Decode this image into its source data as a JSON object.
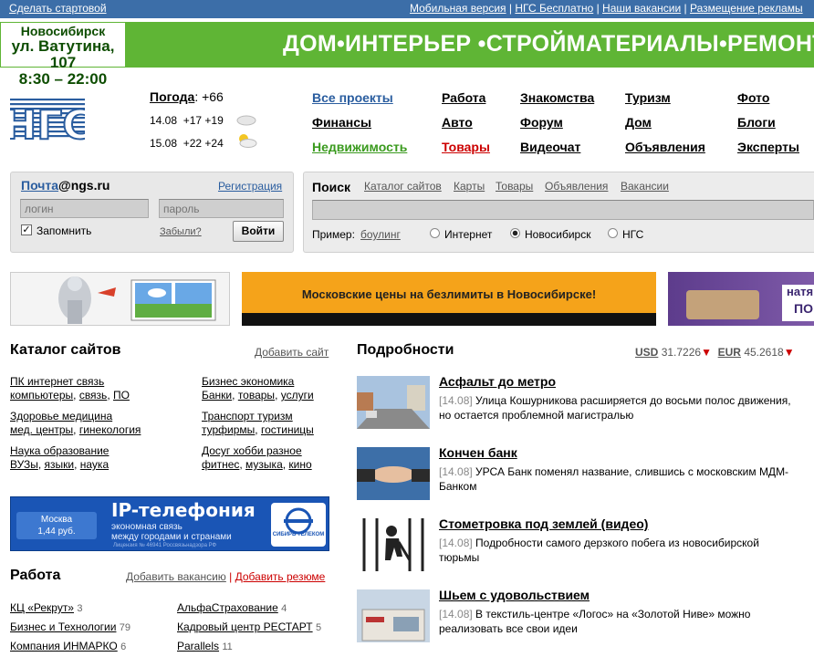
{
  "topbar": {
    "make_home": "Сделать стартовой",
    "links": [
      "Мобильная версия",
      "НГС Бесплатно",
      "Наши вакансии",
      "Размещение рекламы"
    ]
  },
  "banner": {
    "addr_city": "Новосибирск",
    "addr_street": "ул. Ватутина, 107",
    "addr_hours": "8:30 – 22:00",
    "text": "ДОМ•ИНТЕРЬЕР •СТРОЙМАТЕРИАЛЫ•РЕМОНТ •"
  },
  "logo": {
    "text": "НГС"
  },
  "weather": {
    "label": "Погода",
    "current": ": +66",
    "rows": [
      {
        "date": "14.08",
        "temps": "+17 +19"
      },
      {
        "date": "15.08",
        "temps": "+22 +24"
      }
    ]
  },
  "projects": [
    [
      "Все проекты",
      "Работа",
      "Знакомства",
      "Туризм",
      "Фото"
    ],
    [
      "Финансы",
      "Авто",
      "Форум",
      "Дом",
      "Блоги"
    ],
    [
      "Недвижимость",
      "Товары",
      "Видеочат",
      "Объявления",
      "Эксперты"
    ]
  ],
  "mail": {
    "link": "Почта",
    "domain": "@ngs.ru",
    "register": "Регистрация",
    "login_placeholder": "логин",
    "password_placeholder": "пароль",
    "remember": "Запомнить",
    "forgot": "Забыли?",
    "submit": "Войти"
  },
  "search": {
    "label": "Поиск",
    "tabs": [
      "Каталог сайтов",
      "Карты",
      "Товары",
      "Объявления",
      "Вакансии"
    ],
    "example_label": "Пример:",
    "example_link": "боулинг",
    "scopes": [
      "Интернет",
      "Новосибирск",
      "НГС"
    ],
    "selected_scope": "Новосибирск"
  },
  "ads": {
    "middle_text": "Московские цены на безлимиты в Новосибирске!",
    "right_text_1": "натя",
    "right_text_2": "ПО"
  },
  "catalog": {
    "title": "Каталог сайтов",
    "add": "Добавить сайт",
    "groups": [
      {
        "head": "ПК интернет связь",
        "items": [
          "компьютеры",
          "связь",
          "ПО"
        ]
      },
      {
        "head": "Бизнес экономика",
        "items": [
          "Банки",
          "товары",
          "услуги"
        ]
      },
      {
        "head": "Здоровье медицина",
        "items": [
          "мед. центры",
          "гинекология"
        ]
      },
      {
        "head": "Транспорт туризм",
        "items": [
          "турфирмы",
          "гостиницы"
        ]
      },
      {
        "head": "Наука образование",
        "items": [
          "ВУЗы",
          "языки",
          "наука"
        ]
      },
      {
        "head": "Досуг хобби разное",
        "items": [
          "фитнес",
          "музыка",
          "кино"
        ]
      }
    ]
  },
  "ip_ad": {
    "title": "IP-телефония",
    "city": "Москва",
    "price": "1,44 руб.",
    "line1": "экономная связь",
    "line2": "между городами и странами",
    "license": "Лицензия № 46941 Россвязьнадзора РФ",
    "brand": "СИБИРЬ ТЕЛЕКОМ"
  },
  "jobs": {
    "title": "Работа",
    "add_vacancy": "Добавить вакансию",
    "add_resume": "Добавить резюме",
    "left": [
      {
        "name": "КЦ «Рекрут»",
        "count": "3"
      },
      {
        "name": "Бизнес и Технологии",
        "count": "79"
      },
      {
        "name": "Компания ИНМАРКО",
        "count": "6"
      }
    ],
    "right": [
      {
        "name": "АльфаСтрахование",
        "count": "4"
      },
      {
        "name": "Кадровый центр РЕСТАРТ",
        "count": "5"
      },
      {
        "name": "Parallels",
        "count": "11"
      }
    ]
  },
  "news": {
    "title": "Подробности",
    "usd_label": "USD",
    "usd": "31.7226",
    "eur_label": "EUR",
    "eur": "45.2618",
    "items": [
      {
        "title": "Асфальт до метро",
        "date": "[14.08]",
        "text": "Улица Кошурникова расширяется до восьми полос движения, но остается проблемной магистралью"
      },
      {
        "title": "Кончен банк",
        "date": "[14.08]",
        "text": "УРСА Банк поменял название, слившись с московским МДМ-Банком"
      },
      {
        "title": "Стометровка под землей (видео)",
        "date": "[14.08]",
        "text": "Подробности самого дерзкого побега из новосибирской тюрьмы"
      },
      {
        "title": "Шьем с удовольствием",
        "date": "[14.08]",
        "text": "В текстиль-центре «Логос» на «Золотой Ниве» можно реализовать все свои идеи"
      }
    ]
  },
  "colors": {
    "brand_blue": "#2a5d9f",
    "banner_green": "#5fb535",
    "link_green": "#3a9a1e",
    "link_red": "#c00000",
    "ad_orange": "#f5a31a"
  }
}
